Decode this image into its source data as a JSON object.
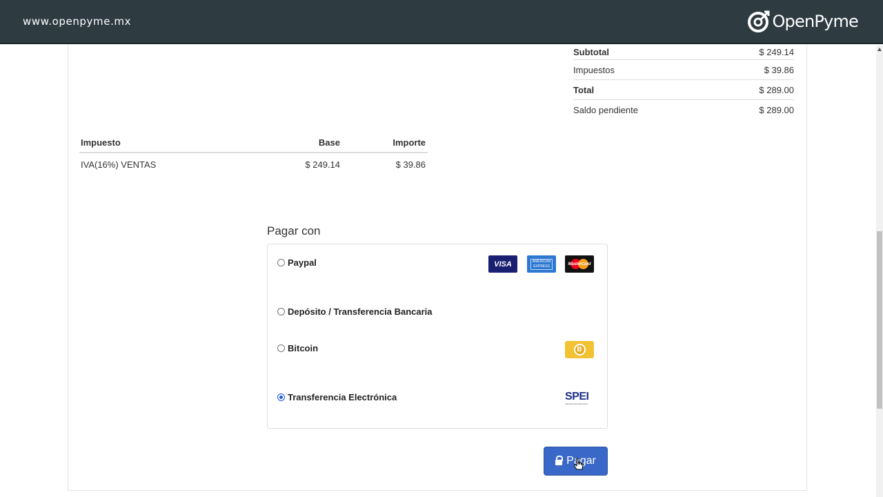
{
  "header": {
    "url": "www.openpyme.mx",
    "brand": "OpenPyme"
  },
  "totals": [
    {
      "label": "Subtotal",
      "value": "$ 249.14",
      "bold": true
    },
    {
      "label": "Impuestos",
      "value": "$ 39.86",
      "bold": false
    },
    {
      "label": "Total",
      "value": "$ 289.00",
      "bold": true
    },
    {
      "label": "Saldo pendiente",
      "value": "$ 289.00",
      "bold": false
    }
  ],
  "tax_table": {
    "headers": [
      "Impuesto",
      "Base",
      "Importe"
    ],
    "rows": [
      [
        "IVA(16%) VENTAS",
        "$ 249.14",
        "$ 39.86"
      ]
    ]
  },
  "payment": {
    "title": "Pagar con",
    "options": [
      {
        "label": "Paypal",
        "selected": false
      },
      {
        "label": "Depósito / Transferencia Bancaria",
        "selected": false
      },
      {
        "label": "Bitcoin",
        "selected": false
      },
      {
        "label": "Transferencia Electrónica",
        "selected": true
      }
    ],
    "logos": {
      "visa": "VISA",
      "amex": "AMERICAN EXPRESS",
      "mastercard": "MasterCard",
      "bitcoin": "B",
      "spei": "SPEI",
      "spei_sub": "transferencia electrónica"
    },
    "button_label": "Pagar"
  },
  "colors": {
    "header_bg": "#2e3b41",
    "button_bg": "#3a68c8",
    "radio_selected": "#1a56e8"
  }
}
